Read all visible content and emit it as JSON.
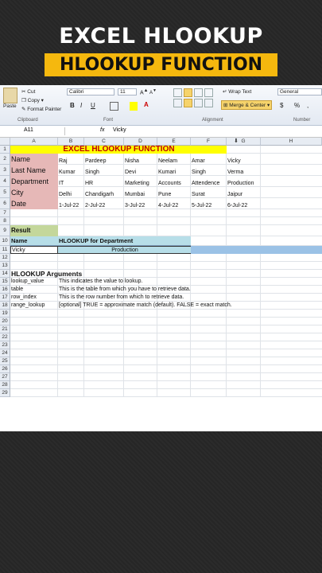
{
  "banner": {
    "title": "EXCEL HLOOKUP",
    "subtitle": "HLOOKUP FUNCTION"
  },
  "ribbon": {
    "paste": "Paste",
    "cut": "Cut",
    "copy": "Copy",
    "format_painter": "Format Painter",
    "clipboard": "Clipboard",
    "font_name": "Calibri",
    "font_size": "11",
    "bold": "B",
    "italic": "I",
    "underline": "U",
    "font_group": "Font",
    "wrap_text": "Wrap Text",
    "merge_center": "Merge & Center",
    "alignment_group": "Alignment",
    "number_format": "General",
    "currency": "$",
    "percent": "%",
    "comma": ",",
    "number_group": "Number"
  },
  "formula_bar": {
    "name_box": "A11",
    "fx": "fx",
    "value": "Vicky"
  },
  "columns": [
    "A",
    "B",
    "C",
    "D",
    "E",
    "F",
    "G",
    "H"
  ],
  "rows": [
    "1",
    "2",
    "3",
    "4",
    "5",
    "6",
    "7",
    "8",
    "9",
    "10",
    "11",
    "12",
    "13",
    "14",
    "15",
    "16",
    "17",
    "18",
    "19",
    "20",
    "21",
    "22",
    "23",
    "24",
    "25",
    "26",
    "27",
    "28",
    "29"
  ],
  "sheet": {
    "title": "EXCEL HLOOKUP FUNCTION",
    "headers": [
      "Name",
      "Last Name",
      "Department",
      "City",
      "Date"
    ],
    "table": [
      [
        "Raj",
        "Pardeep",
        "Nisha",
        "Neelam",
        "Amar",
        "Vicky"
      ],
      [
        "Kumar",
        "Singh",
        "Devi",
        "Kumari",
        "Singh",
        "Verma"
      ],
      [
        "IT",
        "HR",
        "Marketing",
        "Accounts",
        "Attendence",
        "Production"
      ],
      [
        "Delhi",
        "Chandigarh",
        "Mumbai",
        "Pune",
        "Surat",
        "Jaipur"
      ],
      [
        "1-Jul-22",
        "2-Jul-22",
        "3-Jul-22",
        "4-Jul-22",
        "5-Jul-22",
        "6-Jul-22"
      ]
    ],
    "result_label": "Result",
    "name_label": "Name",
    "lookup_label": "HLOOKUP for Department",
    "lookup_name": "Vicky",
    "lookup_result": "Production",
    "args_title": "HLOOKUP Arguments",
    "args": [
      {
        "name": "lookup_value",
        "desc": "This indicates the value to lookup."
      },
      {
        "name": "table",
        "desc": "This is the table from which you have to retrieve data."
      },
      {
        "name": "row_index",
        "desc": "This is the row number from which to retrieve data."
      },
      {
        "name": "range_lookup",
        "desc": "[optional] TRUE = approximate match (default). FALSE = exact match."
      }
    ]
  },
  "colors": {
    "title_yellow": "#ffff00",
    "header_pink": "#e6b8b7",
    "result_green": "#c4d79b",
    "lookup_blue": "#b7dee8",
    "row11_blue": "#9bc2e6",
    "banner_gold": "#f5b80e"
  }
}
